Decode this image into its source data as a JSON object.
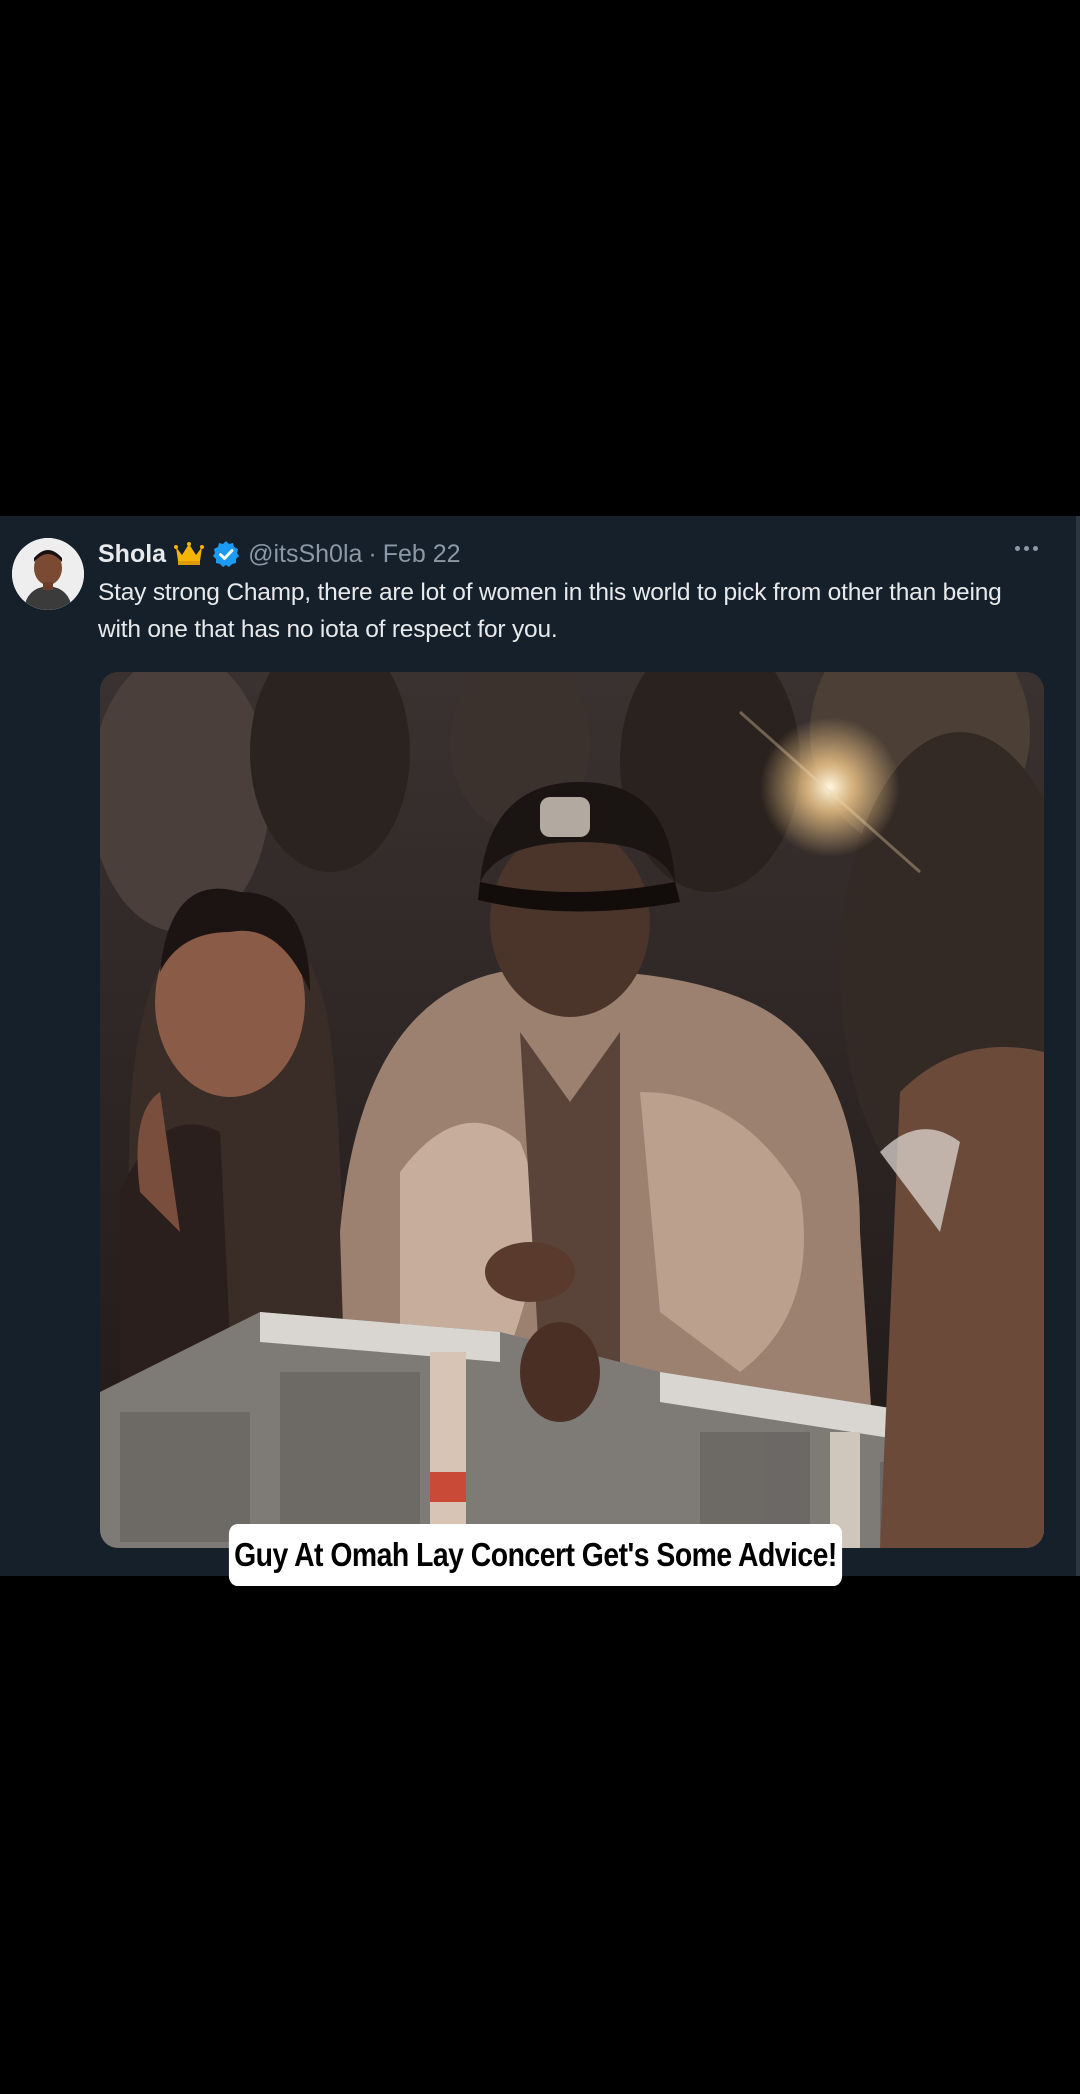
{
  "tweet": {
    "display_name": "Shola",
    "handle": "@itsSh0la",
    "separator": "·",
    "date": "Feb 22",
    "text": "Stay strong Champ, there are lot of women in this world to pick from other than being with one that has no iota of respect for you.",
    "badges": [
      "crown-icon",
      "verified-icon"
    ],
    "verified_color": "#1d9bf0",
    "crown_color": "#f4b400",
    "more_icon": "more-icon"
  },
  "caption": {
    "text": "Guy At Omah Lay Concert Get's Some Advice!"
  },
  "colors": {
    "background": "#000000",
    "card_background": "#15202b",
    "primary_text": "#e7e9ea",
    "secondary_text": "#8b98a5"
  }
}
